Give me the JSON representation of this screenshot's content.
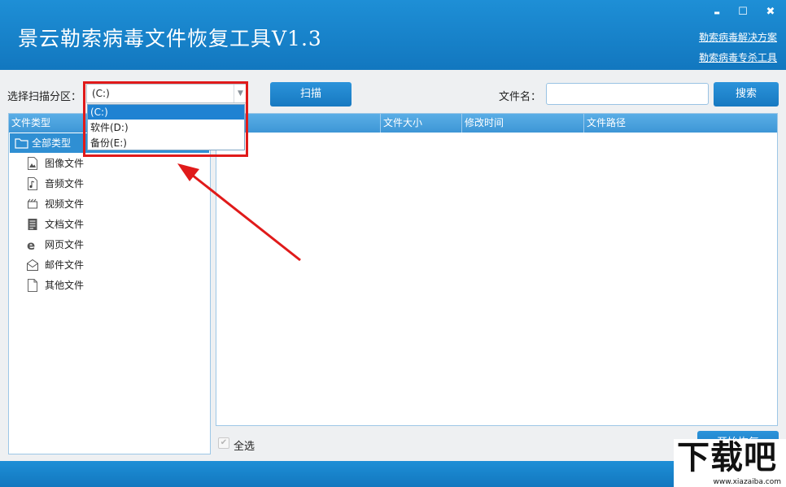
{
  "window": {
    "title": "景云勒索病毒文件恢复工具V1.3",
    "controls": {
      "minimize": "▬",
      "maximize": "☐",
      "close": "✖"
    },
    "links": [
      "勒索病毒解决方案",
      "勒索病毒专杀工具"
    ]
  },
  "toolbar": {
    "partition_label": "选择扫描分区：",
    "partition_value": "(C:)",
    "scan_button": "扫描",
    "filename_label": "文件名：",
    "filename_value": "",
    "search_button": "搜索"
  },
  "dropdown": {
    "options": [
      "(C:)",
      "软件(D:)",
      "备份(E:)"
    ],
    "selected_index": 0
  },
  "tree": {
    "header": "文件类型",
    "root": "全部类型",
    "items": [
      {
        "label": "图像文件",
        "icon": "image-file-icon"
      },
      {
        "label": "音频文件",
        "icon": "audio-file-icon"
      },
      {
        "label": "视频文件",
        "icon": "video-file-icon"
      },
      {
        "label": "文档文件",
        "icon": "document-file-icon"
      },
      {
        "label": "网页文件",
        "icon": "web-file-icon"
      },
      {
        "label": "邮件文件",
        "icon": "mail-file-icon"
      },
      {
        "label": "其他文件",
        "icon": "other-file-icon"
      }
    ]
  },
  "table": {
    "columns": [
      "",
      "文件大小",
      "修改时间",
      "文件路径"
    ],
    "rows": []
  },
  "footer": {
    "select_all": "全选",
    "recover_button": "开始恢复"
  },
  "watermark": {
    "text": "下载吧",
    "url": "www.xiazaiba.com"
  },
  "colors": {
    "accent": "#1f82d2",
    "highlight": "#e01a1a"
  }
}
